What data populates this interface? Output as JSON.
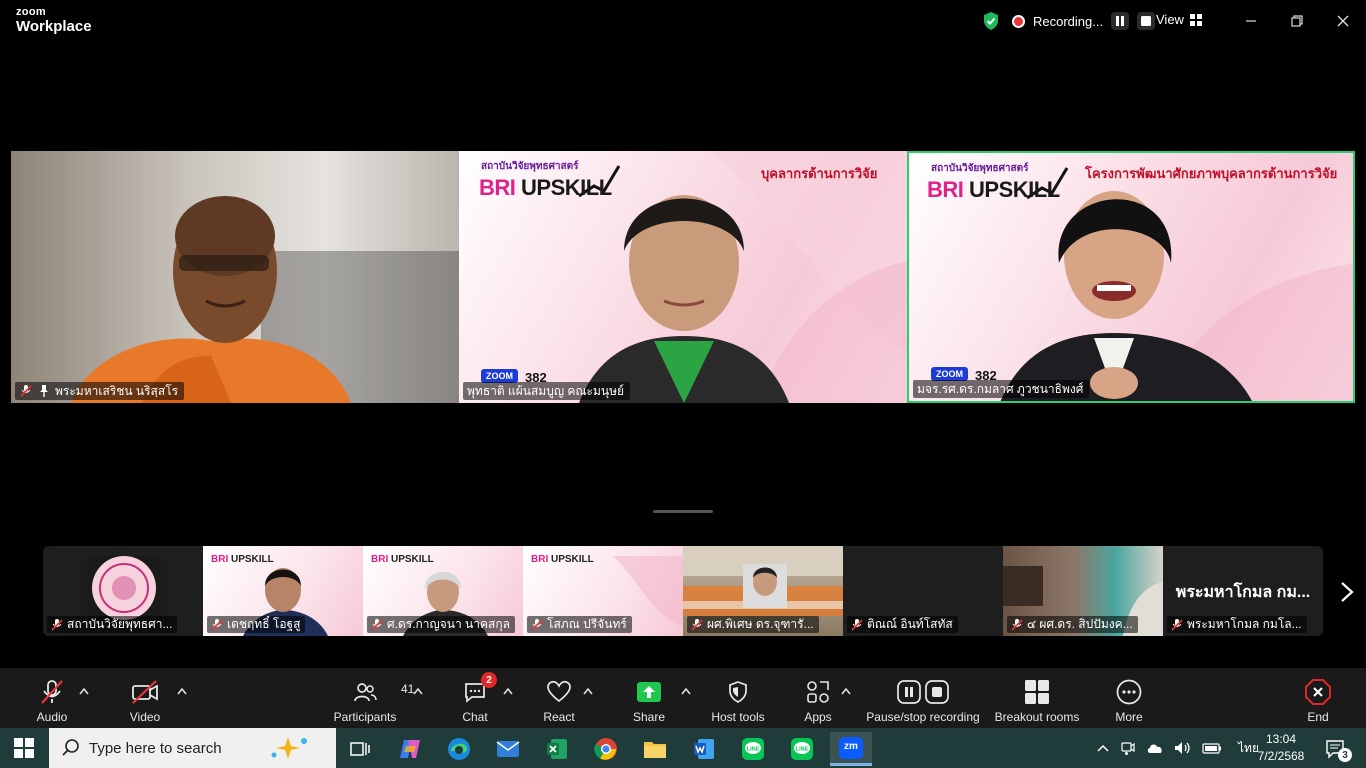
{
  "window": {
    "brand_top": "zoom",
    "brand_bottom": "Workplace",
    "recording_label": "Recording...",
    "view_label": "View"
  },
  "tiles": [
    {
      "name": "พระมหาเสริชน นริสฺสโร",
      "muted": true,
      "pinned": true
    },
    {
      "name": "พุทธาติ แผ้นสมบูญ คณะมนุษย์",
      "muted": false,
      "slide_title": "บุคลากรด้านการวิจัย",
      "zoom_label": "ZOOM",
      "zoom_number": "382",
      "brand_bri": "BRI",
      "brand_upskill": "UPSKILL",
      "institute": "สถาบันวิจัยพุทธศาสตร์"
    },
    {
      "name": "มจร.รศ.ดร.กมลาศ ภูวชนาธิพงศ์",
      "muted": false,
      "active_speaker": true,
      "slide_title": "โครงการพัฒนาศักยภาพบุคลากรด้านการวิจัย",
      "zoom_label": "ZOOM",
      "zoom_number": "382",
      "brand_bri": "BRI",
      "brand_upskill": "UPSKILL",
      "institute": "สถาบันวิจัยพุทธศาสตร์"
    }
  ],
  "thumbnails": [
    {
      "name": "สถาบันวิจัยพุทธศา...",
      "muted": true
    },
    {
      "name": "เดชฤทธิ์ โอฐสู",
      "muted": true
    },
    {
      "name": "ศ.ดร.กาญจนา นาคสกุล",
      "muted": true
    },
    {
      "name": "โสภณ ปรีจันทร์",
      "muted": true
    },
    {
      "name": "ผศ.พิเศษ ดร.จุฑารั...",
      "muted": true
    },
    {
      "name": "ติณณ์ อินท์โสทัส",
      "muted": true
    },
    {
      "name": "๔ ผศ.ดร. สิปปัมงค...",
      "muted": true
    },
    {
      "name": "พระมหาโกมล กมโล...",
      "muted": true,
      "big_label": "พระมหาโกมล กม..."
    }
  ],
  "toolbar": {
    "audio": "Audio",
    "video": "Video",
    "participants": "Participants",
    "participants_count": "41",
    "chat": "Chat",
    "chat_badge": "2",
    "react": "React",
    "share": "Share",
    "host_tools": "Host tools",
    "apps": "Apps",
    "pause_stop": "Pause/stop recording",
    "breakout": "Breakout rooms",
    "more": "More",
    "end": "End"
  },
  "taskbar": {
    "search_placeholder": "Type here to search",
    "language": "ไทย",
    "time": "13:04",
    "date": "7/2/2568",
    "notif_count": "3",
    "zoom_app": "zm"
  },
  "colors": {
    "active_border": "#2ecc71",
    "record_red": "#e8353a",
    "share_green": "#1fc84f",
    "end_red": "#e02828"
  }
}
